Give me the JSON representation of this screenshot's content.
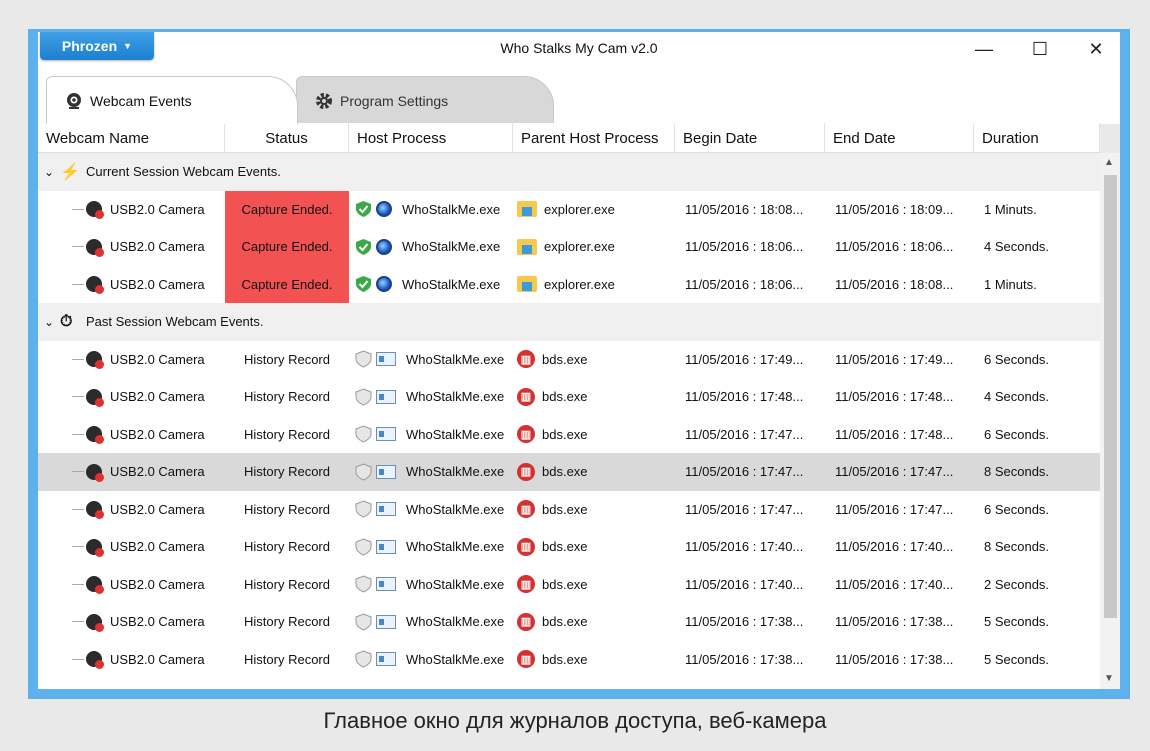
{
  "window": {
    "menu_button": "Phrozen",
    "title": "Who Stalks My Cam v2.0",
    "minimize": "—",
    "maximize": "☐",
    "close": "✕"
  },
  "tabs": [
    {
      "label": "Webcam Events",
      "icon": "webcam-icon"
    },
    {
      "label": "Program Settings",
      "icon": "gear-icon"
    }
  ],
  "columns": [
    "Webcam Name",
    "Status",
    "Host Process",
    "Parent Host Process",
    "Begin Date",
    "End Date",
    "Duration"
  ],
  "groups": {
    "current": "Current Session Webcam Events.",
    "past": "Past Session Webcam Events."
  },
  "current_rows": [
    {
      "cam": "USB2.0 Camera",
      "status": "Capture Ended.",
      "host": "WhoStalkMe.exe",
      "parent": "explorer.exe",
      "begin": "11/05/2016 : 18:08...",
      "end": "11/05/2016 : 18:09...",
      "dur": "1 Minuts."
    },
    {
      "cam": "USB2.0 Camera",
      "status": "Capture Ended.",
      "host": "WhoStalkMe.exe",
      "parent": "explorer.exe",
      "begin": "11/05/2016 : 18:06...",
      "end": "11/05/2016 : 18:06...",
      "dur": "4 Seconds."
    },
    {
      "cam": "USB2.0 Camera",
      "status": "Capture Ended.",
      "host": "WhoStalkMe.exe",
      "parent": "explorer.exe",
      "begin": "11/05/2016 : 18:06...",
      "end": "11/05/2016 : 18:08...",
      "dur": "1 Minuts."
    }
  ],
  "past_rows": [
    {
      "cam": "USB2.0 Camera",
      "status": "History Record",
      "host": "WhoStalkMe.exe",
      "parent": "bds.exe",
      "begin": "11/05/2016 : 17:49...",
      "end": "11/05/2016 : 17:49...",
      "dur": "6 Seconds."
    },
    {
      "cam": "USB2.0 Camera",
      "status": "History Record",
      "host": "WhoStalkMe.exe",
      "parent": "bds.exe",
      "begin": "11/05/2016 : 17:48...",
      "end": "11/05/2016 : 17:48...",
      "dur": "4 Seconds."
    },
    {
      "cam": "USB2.0 Camera",
      "status": "History Record",
      "host": "WhoStalkMe.exe",
      "parent": "bds.exe",
      "begin": "11/05/2016 : 17:47...",
      "end": "11/05/2016 : 17:48...",
      "dur": "6 Seconds."
    },
    {
      "cam": "USB2.0 Camera",
      "status": "History Record",
      "host": "WhoStalkMe.exe",
      "parent": "bds.exe",
      "begin": "11/05/2016 : 17:47...",
      "end": "11/05/2016 : 17:47...",
      "dur": "8 Seconds."
    },
    {
      "cam": "USB2.0 Camera",
      "status": "History Record",
      "host": "WhoStalkMe.exe",
      "parent": "bds.exe",
      "begin": "11/05/2016 : 17:47...",
      "end": "11/05/2016 : 17:47...",
      "dur": "6 Seconds."
    },
    {
      "cam": "USB2.0 Camera",
      "status": "History Record",
      "host": "WhoStalkMe.exe",
      "parent": "bds.exe",
      "begin": "11/05/2016 : 17:40...",
      "end": "11/05/2016 : 17:40...",
      "dur": "8 Seconds."
    },
    {
      "cam": "USB2.0 Camera",
      "status": "History Record",
      "host": "WhoStalkMe.exe",
      "parent": "bds.exe",
      "begin": "11/05/2016 : 17:40...",
      "end": "11/05/2016 : 17:40...",
      "dur": "2 Seconds."
    },
    {
      "cam": "USB2.0 Camera",
      "status": "History Record",
      "host": "WhoStalkMe.exe",
      "parent": "bds.exe",
      "begin": "11/05/2016 : 17:38...",
      "end": "11/05/2016 : 17:38...",
      "dur": "5 Seconds."
    },
    {
      "cam": "USB2.0 Camera",
      "status": "History Record",
      "host": "WhoStalkMe.exe",
      "parent": "bds.exe",
      "begin": "11/05/2016 : 17:38...",
      "end": "11/05/2016 : 17:38...",
      "dur": "5 Seconds."
    }
  ],
  "selected_past_row": 3,
  "caption": "Главное окно для журналов доступа, веб-камера"
}
